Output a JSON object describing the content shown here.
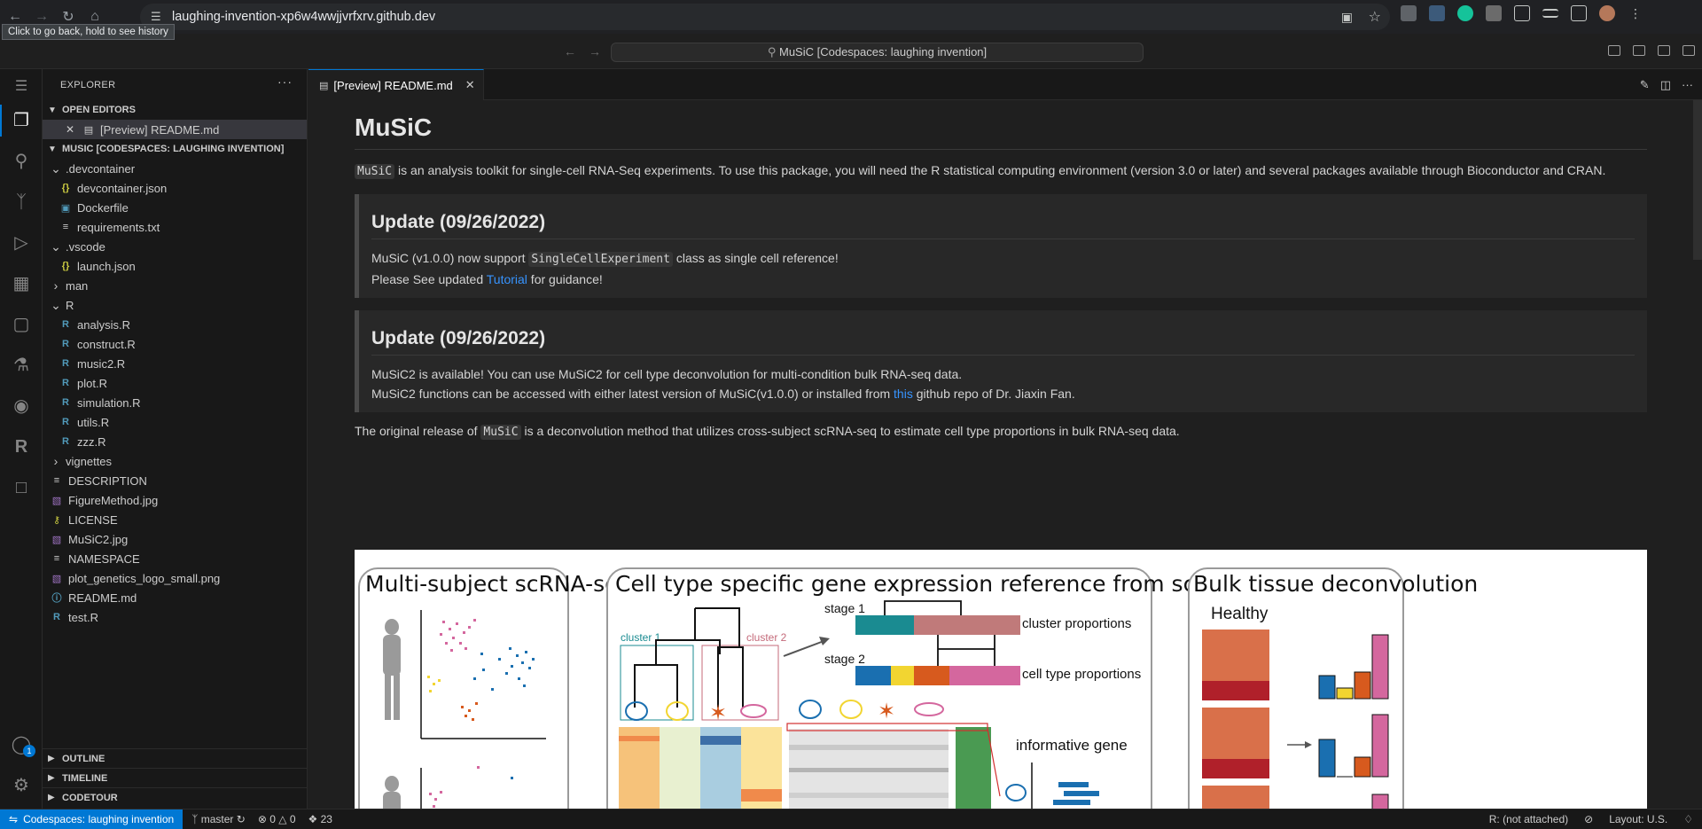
{
  "browser": {
    "url": "laughing-invention-xp6w4wwjjvrfxrv.github.dev",
    "tooltip": "Click to go back, hold to see history"
  },
  "titlebar": {
    "command_center": "MuSiC [Codespaces: laughing invention]"
  },
  "explorer": {
    "header": "EXPLORER",
    "open_editors_title": "OPEN EDITORS",
    "open_editor_item": "[Preview] README.md",
    "workspace_title": "MUSIC [CODESPACES: LAUGHING INVENTION]",
    "tree": [
      {
        "label": ".devcontainer",
        "kind": "folder-open",
        "depth": 1
      },
      {
        "label": "devcontainer.json",
        "kind": "json",
        "depth": 2
      },
      {
        "label": "Dockerfile",
        "kind": "docker",
        "depth": 2
      },
      {
        "label": "requirements.txt",
        "kind": "text",
        "depth": 2
      },
      {
        "label": ".vscode",
        "kind": "folder-open",
        "depth": 1
      },
      {
        "label": "launch.json",
        "kind": "json",
        "depth": 2
      },
      {
        "label": "man",
        "kind": "folder-closed",
        "depth": 1
      },
      {
        "label": "R",
        "kind": "folder-open",
        "depth": 1
      },
      {
        "label": "analysis.R",
        "kind": "r",
        "depth": 2
      },
      {
        "label": "construct.R",
        "kind": "r",
        "depth": 2
      },
      {
        "label": "music2.R",
        "kind": "r",
        "depth": 2
      },
      {
        "label": "plot.R",
        "kind": "r",
        "depth": 2
      },
      {
        "label": "simulation.R",
        "kind": "r",
        "depth": 2
      },
      {
        "label": "utils.R",
        "kind": "r",
        "depth": 2
      },
      {
        "label": "zzz.R",
        "kind": "r",
        "depth": 2
      },
      {
        "label": "vignettes",
        "kind": "folder-closed",
        "depth": 1
      },
      {
        "label": "DESCRIPTION",
        "kind": "text",
        "depth": 1
      },
      {
        "label": "FigureMethod.jpg",
        "kind": "image",
        "depth": 1
      },
      {
        "label": "LICENSE",
        "kind": "license",
        "depth": 1
      },
      {
        "label": "MuSiC2.jpg",
        "kind": "image",
        "depth": 1
      },
      {
        "label": "NAMESPACE",
        "kind": "text",
        "depth": 1
      },
      {
        "label": "plot_genetics_logo_small.png",
        "kind": "image",
        "depth": 1
      },
      {
        "label": "README.md",
        "kind": "info",
        "depth": 1
      },
      {
        "label": "test.R",
        "kind": "r",
        "depth": 1
      }
    ],
    "outline_title": "OUTLINE",
    "timeline_title": "TIMELINE",
    "codetour_title": "CODETOUR"
  },
  "editor": {
    "tab_label": "[Preview] README.md"
  },
  "readme": {
    "title": "MuSiC",
    "intro_code": "MuSiC",
    "intro_text": " is an analysis toolkit for single-cell RNA-Seq experiments. To use this package, you will need the R statistical computing environment (version 3.0 or later) and several packages available through Bioconductor and CRAN.",
    "update1": {
      "heading": "Update (09/26/2022)",
      "line1_a": "MuSiC (v1.0.0) now support ",
      "line1_code": "SingleCellExperiment",
      "line1_b": " class as single cell reference!",
      "line2_a": "Please See updated ",
      "line2_link": "Tutorial",
      "line2_b": " for guidance!"
    },
    "update2": {
      "heading": "Update (09/26/2022)",
      "line1": "MuSiC2 is available! You can use MuSiC2 for cell type deconvolution for multi-condition bulk RNA-seq data.",
      "line2_a": "MuSiC2 functions can be accessed with either latest version of MuSiC(v1.0.0) or installed from ",
      "line2_link": "this",
      "line2_b": " github repo of Dr. Jiaxin Fan."
    },
    "orig_a": "The original release of ",
    "orig_code": "MuSiC",
    "orig_b": " is a deconvolution method that utilizes cross-subject scRNA-seq to estimate cell type proportions in bulk RNA-seq data."
  },
  "figure": {
    "panel1_title": "Multi-subject scRNA-seq",
    "panel2_title": "Cell type specific gene expression reference from scRNA-seq",
    "panel3_title": "Bulk tissue deconvolution",
    "stage1": "stage 1",
    "stage2": "stage 2",
    "cluster1": "cluster 1",
    "cluster2": "cluster 2",
    "cluster_proportions": "cluster proportions",
    "cell_type_proportions": "cell type proportions",
    "informative_gene": "informative gene",
    "healthy": "Healthy"
  },
  "statusbar": {
    "remote": "Codespaces: laughing invention",
    "branch": "master",
    "errors": "0",
    "warnings": "0",
    "ports": "23",
    "r_status": "R: (not attached)",
    "layout": "Layout: U.S."
  },
  "activity_badge": "1",
  "colors": {
    "accent": "#0078d4",
    "link": "#3794ff",
    "fig_blue": "#1a6fb0",
    "fig_pink": "#d4679e",
    "fig_orange": "#d75a1e",
    "fig_yellow": "#f2d531",
    "fig_teal": "#1a8b91"
  }
}
